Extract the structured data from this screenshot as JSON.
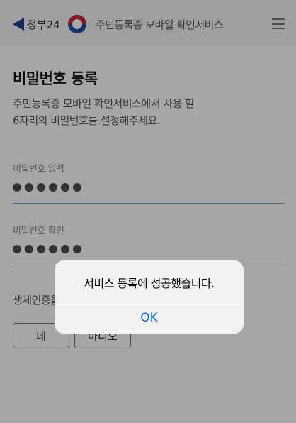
{
  "header": {
    "back_label": "정부24",
    "title": "주민등록증 모바일 확인서비스"
  },
  "main": {
    "page_title": "비밀번호 등록",
    "description_line1": "주민등록증 모바일 확인서비스에서 사용 할",
    "description_line2": "6자리의 비밀번호를 설정해주세요.",
    "password_field": {
      "label": "비밀번호 입력",
      "digits_entered": 6
    },
    "confirm_field": {
      "label": "비밀번호 확인",
      "digits_entered": 6
    },
    "biometric_label": "생체인증을 사용하시겠습니까?",
    "yes_label": "네",
    "no_label": "아니오"
  },
  "dialog": {
    "message": "서비스 등록에 성공했습니다.",
    "ok_label": "OK"
  },
  "colors": {
    "accent_blue": "#0a64d8",
    "field_underline_active": "#7aa0d8"
  }
}
